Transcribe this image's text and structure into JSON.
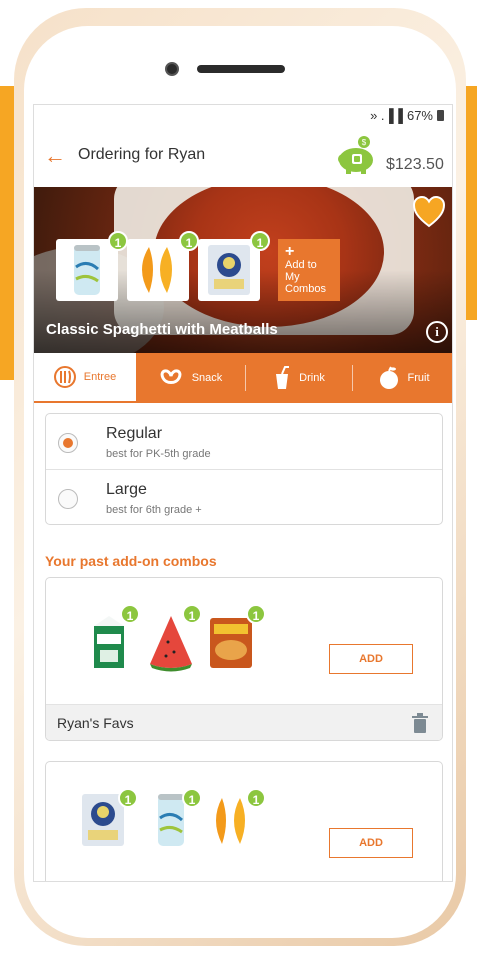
{
  "status": {
    "signal": "» .▐▐",
    "battery": "67%"
  },
  "header": {
    "title": "Ordering for Ryan",
    "balance": "$123.50"
  },
  "hero": {
    "title": "Classic Spaghetti with Meatballs",
    "addons": [
      {
        "name": "La Croix",
        "count": "1"
      },
      {
        "name": "Orange slices",
        "count": "1"
      },
      {
        "name": "Pirate's Booty",
        "count": "1"
      }
    ],
    "add_combo_lines": [
      "Add to",
      "My",
      "Combos"
    ],
    "add_combo_plus": "+"
  },
  "tabs": [
    {
      "label": "Entree",
      "icon": "entree-icon"
    },
    {
      "label": "Snack",
      "icon": "pretzel-icon"
    },
    {
      "label": "Drink",
      "icon": "drink-icon"
    },
    {
      "label": "Fruit",
      "icon": "apple-icon"
    }
  ],
  "sizes": [
    {
      "name": "Regular",
      "desc": "best for PK-5th grade",
      "selected": true
    },
    {
      "name": "Large",
      "desc": "best for 6th grade +",
      "selected": false
    }
  ],
  "past_combos": {
    "title": "Your past add-on combos",
    "combos": [
      {
        "name": "Ryan's Favs",
        "add_label": "ADD",
        "items": [
          {
            "name": "Clover milk",
            "count": "1"
          },
          {
            "name": "Watermelon",
            "count": "1"
          },
          {
            "name": "Veggie chips",
            "count": "1"
          }
        ]
      },
      {
        "name": "",
        "add_label": "ADD",
        "items": [
          {
            "name": "Pirate's Booty",
            "count": "1"
          },
          {
            "name": "La Croix",
            "count": "1"
          },
          {
            "name": "Orange slices",
            "count": "1"
          }
        ]
      }
    ]
  },
  "colors": {
    "accent": "#e8772e",
    "badge": "#8cc63f",
    "brand_side": "#f6a623"
  }
}
